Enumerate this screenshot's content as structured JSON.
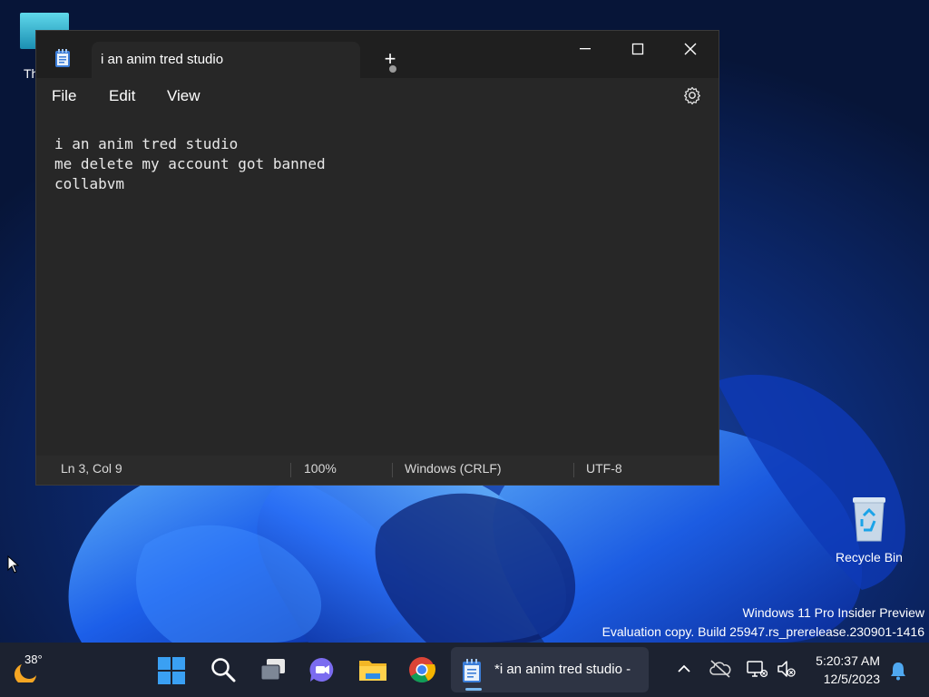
{
  "desktop": {
    "partial_icon_label": "Th",
    "recycle_bin_label": "Recycle Bin",
    "watermark_line1": "Windows 11 Pro Insider Preview",
    "watermark_line2": "Evaluation copy. Build 25947.rs_prerelease.230901-1416"
  },
  "notepad": {
    "tab_title": "i an anim tred studio",
    "tab_unsaved": true,
    "new_tab_label": "+",
    "window_controls": {
      "minimize": "—",
      "maximize": "☐",
      "close": "✕"
    },
    "menu": {
      "file": "File",
      "edit": "Edit",
      "view": "View"
    },
    "content": "i an anim tred studio\nme delete my account got banned\ncollabvm",
    "status": {
      "position": "Ln 3, Col 9",
      "zoom": "100%",
      "line_ending": "Windows (CRLF)",
      "encoding": "UTF-8"
    }
  },
  "taskbar": {
    "weather_temp": "38°",
    "icons": [
      "start-icon",
      "search-icon",
      "task-view-icon",
      "teams-chat-icon",
      "file-explorer-icon",
      "chrome-icon",
      "notepad-icon"
    ],
    "active_app_label": "*i an anim tred studio -",
    "clock_time": "5:20:37 AM",
    "clock_date": "12/5/2023"
  },
  "colors": {
    "accent": "#79b8f0",
    "window_bg": "#272727",
    "titlebar_bg": "#1f1f1f",
    "taskbar_bg": "#1c2230"
  }
}
